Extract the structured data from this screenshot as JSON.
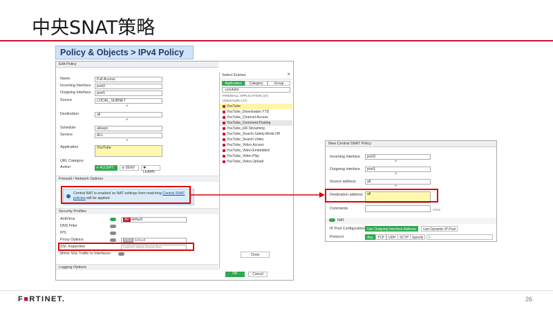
{
  "slide": {
    "title": "中央SNAT策略",
    "page_number": "26",
    "logo_pre": "F",
    "logo_accent": "■",
    "logo_post": "RTINET."
  },
  "banner": "Policy & Objects > IPv4 Policy",
  "edit_policy": {
    "header": "Edit Policy",
    "name_label": "Name",
    "name_value": "Full Access",
    "incoming_label": "Incoming Interface",
    "incoming_value": "port2",
    "outgoing_label": "Outgoing Interface",
    "outgoing_value": "port1",
    "source_label": "Source",
    "source_value": "LOCAL_SUBNET",
    "destination_label": "Destination",
    "destination_value": "all",
    "schedule_label": "Schedule",
    "schedule_value": "always",
    "service_label": "Service",
    "service_value": "ALL",
    "application_label": "Application",
    "application_value": "YouTube",
    "url_label": "URL Category",
    "action_label": "Action",
    "accept": "✔ ACCEPT",
    "deny": "⊘ DENY",
    "learn": "✱ LEARN",
    "firewall_section": "Firewall / Network Options",
    "note_text": "Central NAT is enabled so NAT settings from matching ",
    "note_link": "Central SNAT policies",
    "note_tail": " will be applied.",
    "security_section": "Security Profiles",
    "antivirus_label": "AntiVirus",
    "antivirus_value": "default",
    "av_badge": "AV",
    "dns_label": "DNS Filter",
    "ips_label": "IPS",
    "proxy_label": "Proxy Options",
    "proxy_value": "default",
    "proxy_badge": "PRX",
    "ssl_label": "SSL Inspection",
    "ssl_value": "custom-deep-inspection",
    "mirror_label": "Mirror SSL Traffic to Interfaces",
    "logging_section": "Logging Options",
    "ok": "OK",
    "cancel": "Cancel"
  },
  "select_entries": {
    "header": "Select Entries",
    "tabs": [
      "Application",
      "Category",
      "Group"
    ],
    "search": "youtube",
    "group": "FIREWALL APPLICATION (17)",
    "subgroup": "Video/Audio (17)",
    "items": [
      "YouTube",
      "YouTube_Downloader.YTD",
      "YouTube_Channel.Access",
      "YouTube_Comment.Posting",
      "YouTube_HD.Streaming",
      "YouTube_Search.Safety.Mode.Off",
      "YouTube_Search.Video",
      "YouTube_Video.Access",
      "YouTube_Video.Embedded",
      "YouTube_Video.Play",
      "YouTube_Video.Upload"
    ],
    "close": "Close"
  },
  "central_snat": {
    "header": "New Central SNAT Policy",
    "incoming_label": "Incoming interface",
    "incoming_value": "port3",
    "outgoing_label": "Outgoing interface",
    "outgoing_value": "port1",
    "source_label": "Source address",
    "source_value": "all",
    "destination_label": "Destination address",
    "destination_value": "all",
    "comments_label": "Comments",
    "comments_counter": "0/255",
    "nat_label": "NAT",
    "ippool_label": "IP Pool Configuration",
    "ippool_opt1": "Use Outgoing Interface Address",
    "ippool_opt2": "Use Dynamic IP Pool",
    "protocol_label": "Protocol",
    "protocols": [
      "Any",
      "TCP",
      "UDP",
      "SCTP",
      "Specify"
    ],
    "protocol_number": "0"
  }
}
